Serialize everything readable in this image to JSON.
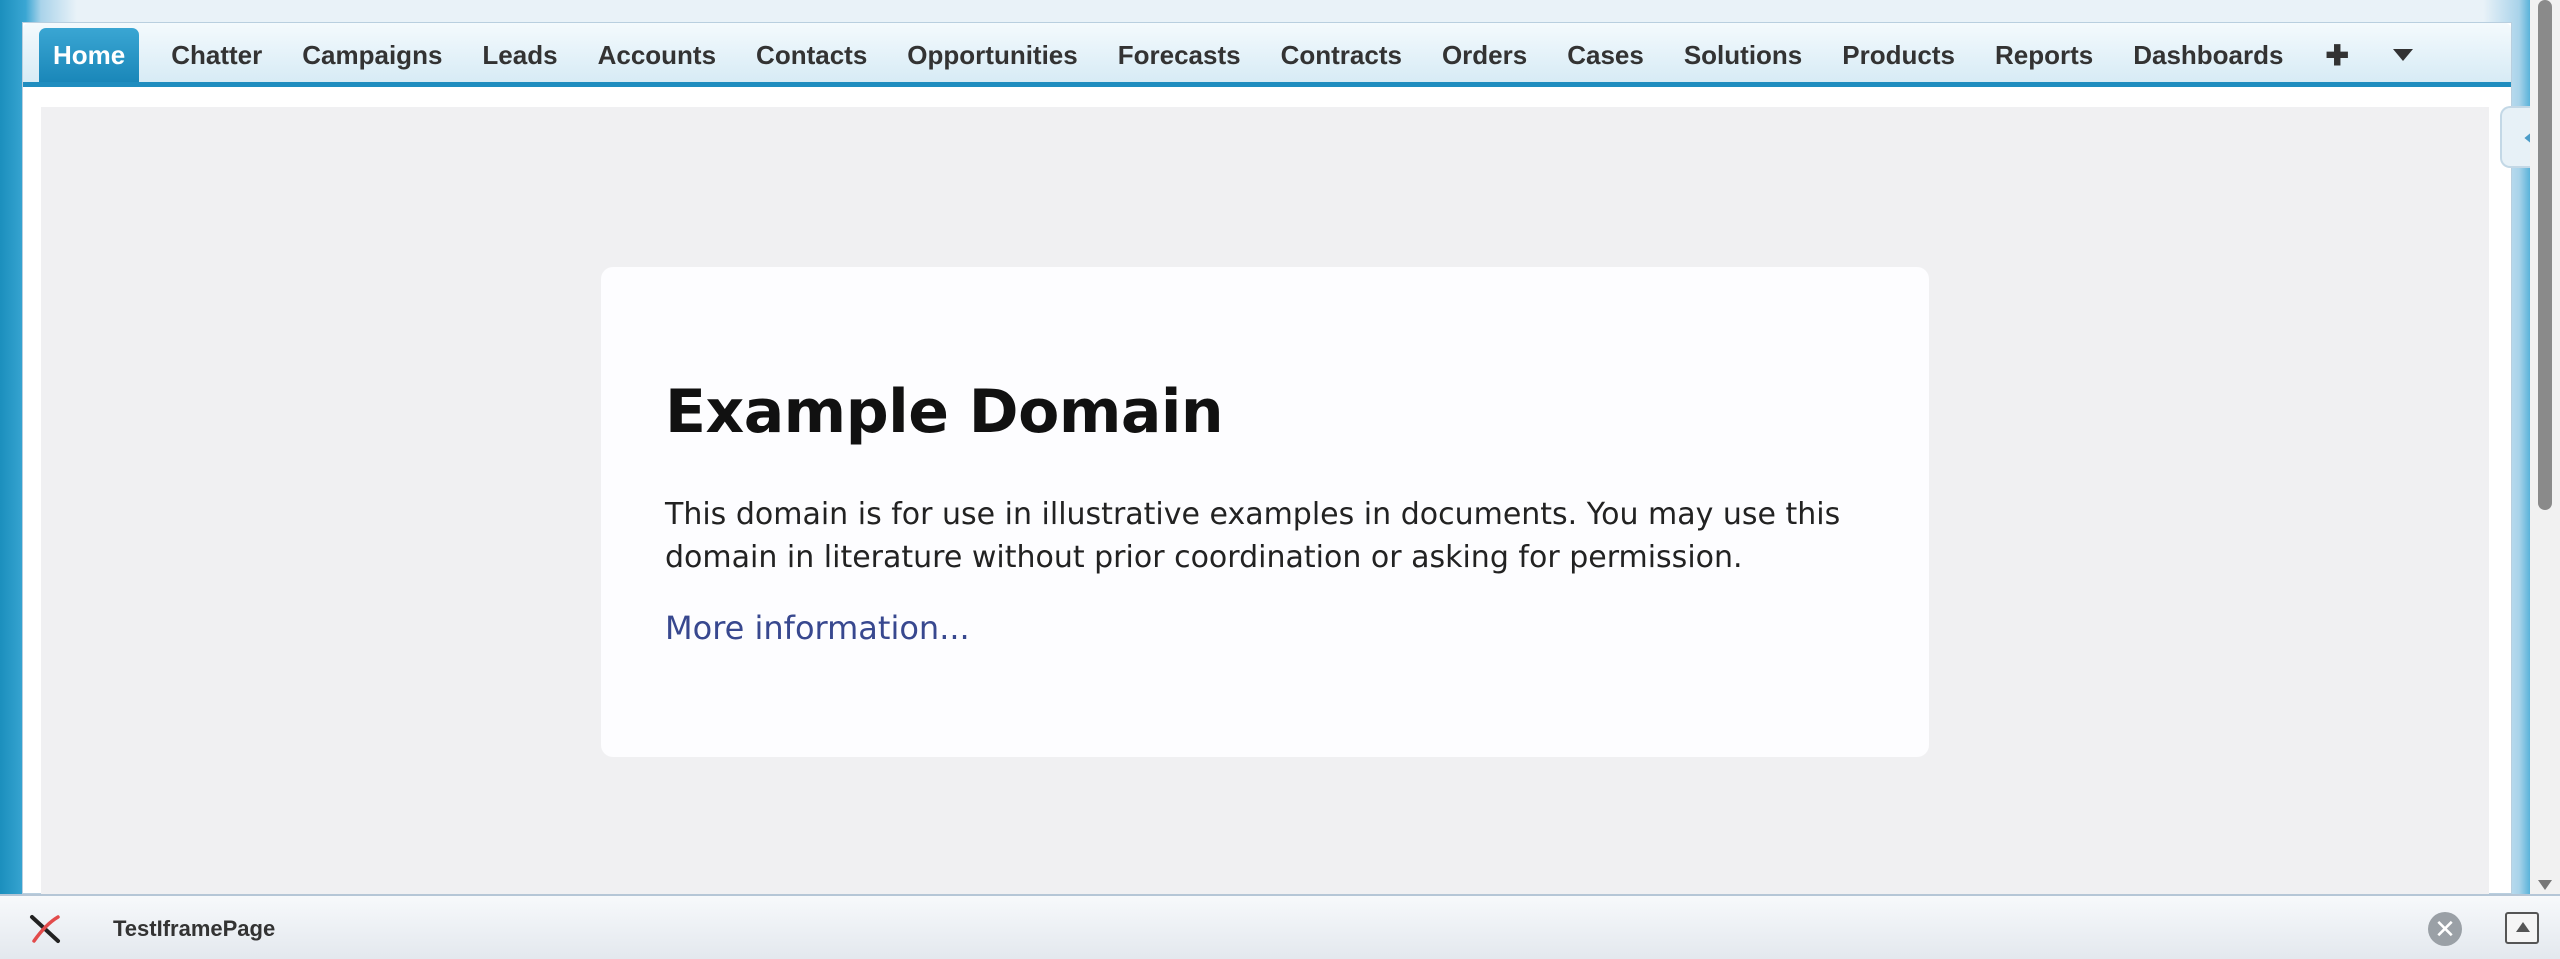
{
  "nav": {
    "tabs": [
      {
        "label": "Home"
      },
      {
        "label": "Chatter"
      },
      {
        "label": "Campaigns"
      },
      {
        "label": "Leads"
      },
      {
        "label": "Accounts"
      },
      {
        "label": "Contacts"
      },
      {
        "label": "Opportunities"
      },
      {
        "label": "Forecasts"
      },
      {
        "label": "Contracts"
      },
      {
        "label": "Orders"
      },
      {
        "label": "Cases"
      },
      {
        "label": "Solutions"
      },
      {
        "label": "Products"
      },
      {
        "label": "Reports"
      },
      {
        "label": "Dashboards"
      }
    ],
    "add_tab_glyph": "✚",
    "more_tabs_icon": "chevron-down-icon",
    "accent_color": "#1f8dbf"
  },
  "iframe": {
    "heading": "Example Domain",
    "body": "This domain is for use in illustrative examples in documents. You may use this domain in literature without prior coordination or asking for permission.",
    "link": "More information..."
  },
  "footer": {
    "title": "TestIframePage",
    "close_glyph": "✕"
  }
}
